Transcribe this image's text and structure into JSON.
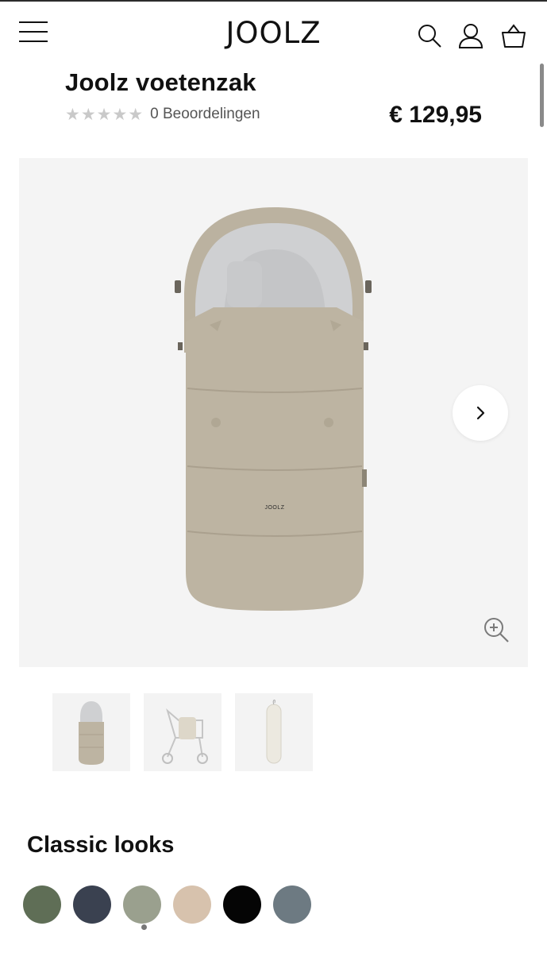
{
  "header": {
    "logo": "JOOLZ",
    "icons": [
      "menu-icon",
      "search-icon",
      "account-icon",
      "basket-icon"
    ]
  },
  "product": {
    "title": "Joolz voetenzak",
    "stars": "★★★★★",
    "reviews_label": "0 Beoordelingen",
    "price": "€ 129,95",
    "image_brand_label": "JOOLZ"
  },
  "gallery": {
    "thumbnail_count": 3,
    "selected_thumbnail": 1
  },
  "classic_looks": {
    "title": "Classic looks",
    "swatches": [
      "#5f6e56",
      "#3a4150",
      "#9aa08e",
      "#d7c2ad",
      "#050505",
      "#6d7a82"
    ],
    "selected_swatch": 3
  },
  "colors": {
    "footmuff": "#bdb4a2",
    "fleece": "#cfd0d1",
    "gallery_bg": "#f4f4f4"
  }
}
